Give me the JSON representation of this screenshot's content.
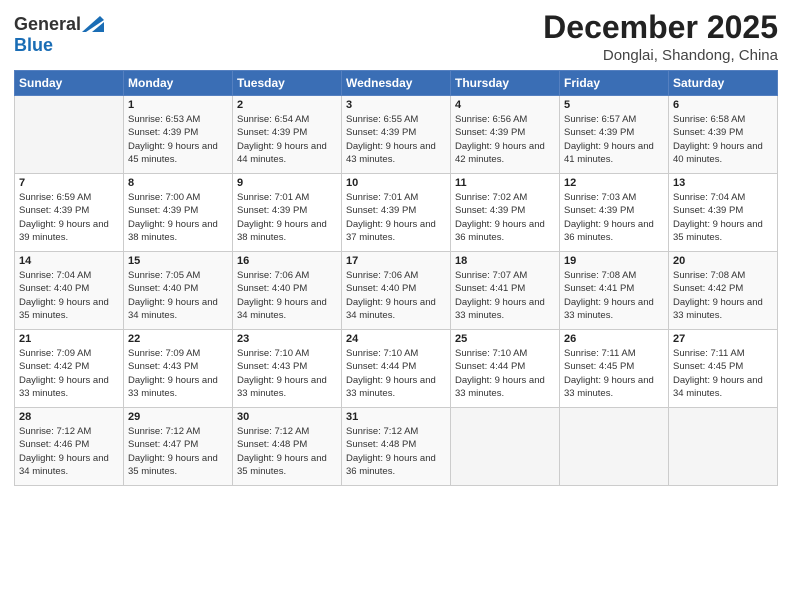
{
  "logo": {
    "general": "General",
    "blue": "Blue"
  },
  "title": "December 2025",
  "location": "Donglai, Shandong, China",
  "days_of_week": [
    "Sunday",
    "Monday",
    "Tuesday",
    "Wednesday",
    "Thursday",
    "Friday",
    "Saturday"
  ],
  "weeks": [
    [
      {
        "day": "",
        "sunrise": "",
        "sunset": "",
        "daylight": ""
      },
      {
        "day": "1",
        "sunrise": "Sunrise: 6:53 AM",
        "sunset": "Sunset: 4:39 PM",
        "daylight": "Daylight: 9 hours and 45 minutes."
      },
      {
        "day": "2",
        "sunrise": "Sunrise: 6:54 AM",
        "sunset": "Sunset: 4:39 PM",
        "daylight": "Daylight: 9 hours and 44 minutes."
      },
      {
        "day": "3",
        "sunrise": "Sunrise: 6:55 AM",
        "sunset": "Sunset: 4:39 PM",
        "daylight": "Daylight: 9 hours and 43 minutes."
      },
      {
        "day": "4",
        "sunrise": "Sunrise: 6:56 AM",
        "sunset": "Sunset: 4:39 PM",
        "daylight": "Daylight: 9 hours and 42 minutes."
      },
      {
        "day": "5",
        "sunrise": "Sunrise: 6:57 AM",
        "sunset": "Sunset: 4:39 PM",
        "daylight": "Daylight: 9 hours and 41 minutes."
      },
      {
        "day": "6",
        "sunrise": "Sunrise: 6:58 AM",
        "sunset": "Sunset: 4:39 PM",
        "daylight": "Daylight: 9 hours and 40 minutes."
      }
    ],
    [
      {
        "day": "7",
        "sunrise": "Sunrise: 6:59 AM",
        "sunset": "Sunset: 4:39 PM",
        "daylight": "Daylight: 9 hours and 39 minutes."
      },
      {
        "day": "8",
        "sunrise": "Sunrise: 7:00 AM",
        "sunset": "Sunset: 4:39 PM",
        "daylight": "Daylight: 9 hours and 38 minutes."
      },
      {
        "day": "9",
        "sunrise": "Sunrise: 7:01 AM",
        "sunset": "Sunset: 4:39 PM",
        "daylight": "Daylight: 9 hours and 38 minutes."
      },
      {
        "day": "10",
        "sunrise": "Sunrise: 7:01 AM",
        "sunset": "Sunset: 4:39 PM",
        "daylight": "Daylight: 9 hours and 37 minutes."
      },
      {
        "day": "11",
        "sunrise": "Sunrise: 7:02 AM",
        "sunset": "Sunset: 4:39 PM",
        "daylight": "Daylight: 9 hours and 36 minutes."
      },
      {
        "day": "12",
        "sunrise": "Sunrise: 7:03 AM",
        "sunset": "Sunset: 4:39 PM",
        "daylight": "Daylight: 9 hours and 36 minutes."
      },
      {
        "day": "13",
        "sunrise": "Sunrise: 7:04 AM",
        "sunset": "Sunset: 4:39 PM",
        "daylight": "Daylight: 9 hours and 35 minutes."
      }
    ],
    [
      {
        "day": "14",
        "sunrise": "Sunrise: 7:04 AM",
        "sunset": "Sunset: 4:40 PM",
        "daylight": "Daylight: 9 hours and 35 minutes."
      },
      {
        "day": "15",
        "sunrise": "Sunrise: 7:05 AM",
        "sunset": "Sunset: 4:40 PM",
        "daylight": "Daylight: 9 hours and 34 minutes."
      },
      {
        "day": "16",
        "sunrise": "Sunrise: 7:06 AM",
        "sunset": "Sunset: 4:40 PM",
        "daylight": "Daylight: 9 hours and 34 minutes."
      },
      {
        "day": "17",
        "sunrise": "Sunrise: 7:06 AM",
        "sunset": "Sunset: 4:40 PM",
        "daylight": "Daylight: 9 hours and 34 minutes."
      },
      {
        "day": "18",
        "sunrise": "Sunrise: 7:07 AM",
        "sunset": "Sunset: 4:41 PM",
        "daylight": "Daylight: 9 hours and 33 minutes."
      },
      {
        "day": "19",
        "sunrise": "Sunrise: 7:08 AM",
        "sunset": "Sunset: 4:41 PM",
        "daylight": "Daylight: 9 hours and 33 minutes."
      },
      {
        "day": "20",
        "sunrise": "Sunrise: 7:08 AM",
        "sunset": "Sunset: 4:42 PM",
        "daylight": "Daylight: 9 hours and 33 minutes."
      }
    ],
    [
      {
        "day": "21",
        "sunrise": "Sunrise: 7:09 AM",
        "sunset": "Sunset: 4:42 PM",
        "daylight": "Daylight: 9 hours and 33 minutes."
      },
      {
        "day": "22",
        "sunrise": "Sunrise: 7:09 AM",
        "sunset": "Sunset: 4:43 PM",
        "daylight": "Daylight: 9 hours and 33 minutes."
      },
      {
        "day": "23",
        "sunrise": "Sunrise: 7:10 AM",
        "sunset": "Sunset: 4:43 PM",
        "daylight": "Daylight: 9 hours and 33 minutes."
      },
      {
        "day": "24",
        "sunrise": "Sunrise: 7:10 AM",
        "sunset": "Sunset: 4:44 PM",
        "daylight": "Daylight: 9 hours and 33 minutes."
      },
      {
        "day": "25",
        "sunrise": "Sunrise: 7:10 AM",
        "sunset": "Sunset: 4:44 PM",
        "daylight": "Daylight: 9 hours and 33 minutes."
      },
      {
        "day": "26",
        "sunrise": "Sunrise: 7:11 AM",
        "sunset": "Sunset: 4:45 PM",
        "daylight": "Daylight: 9 hours and 33 minutes."
      },
      {
        "day": "27",
        "sunrise": "Sunrise: 7:11 AM",
        "sunset": "Sunset: 4:45 PM",
        "daylight": "Daylight: 9 hours and 34 minutes."
      }
    ],
    [
      {
        "day": "28",
        "sunrise": "Sunrise: 7:12 AM",
        "sunset": "Sunset: 4:46 PM",
        "daylight": "Daylight: 9 hours and 34 minutes."
      },
      {
        "day": "29",
        "sunrise": "Sunrise: 7:12 AM",
        "sunset": "Sunset: 4:47 PM",
        "daylight": "Daylight: 9 hours and 35 minutes."
      },
      {
        "day": "30",
        "sunrise": "Sunrise: 7:12 AM",
        "sunset": "Sunset: 4:48 PM",
        "daylight": "Daylight: 9 hours and 35 minutes."
      },
      {
        "day": "31",
        "sunrise": "Sunrise: 7:12 AM",
        "sunset": "Sunset: 4:48 PM",
        "daylight": "Daylight: 9 hours and 36 minutes."
      },
      {
        "day": "",
        "sunrise": "",
        "sunset": "",
        "daylight": ""
      },
      {
        "day": "",
        "sunrise": "",
        "sunset": "",
        "daylight": ""
      },
      {
        "day": "",
        "sunrise": "",
        "sunset": "",
        "daylight": ""
      }
    ]
  ]
}
